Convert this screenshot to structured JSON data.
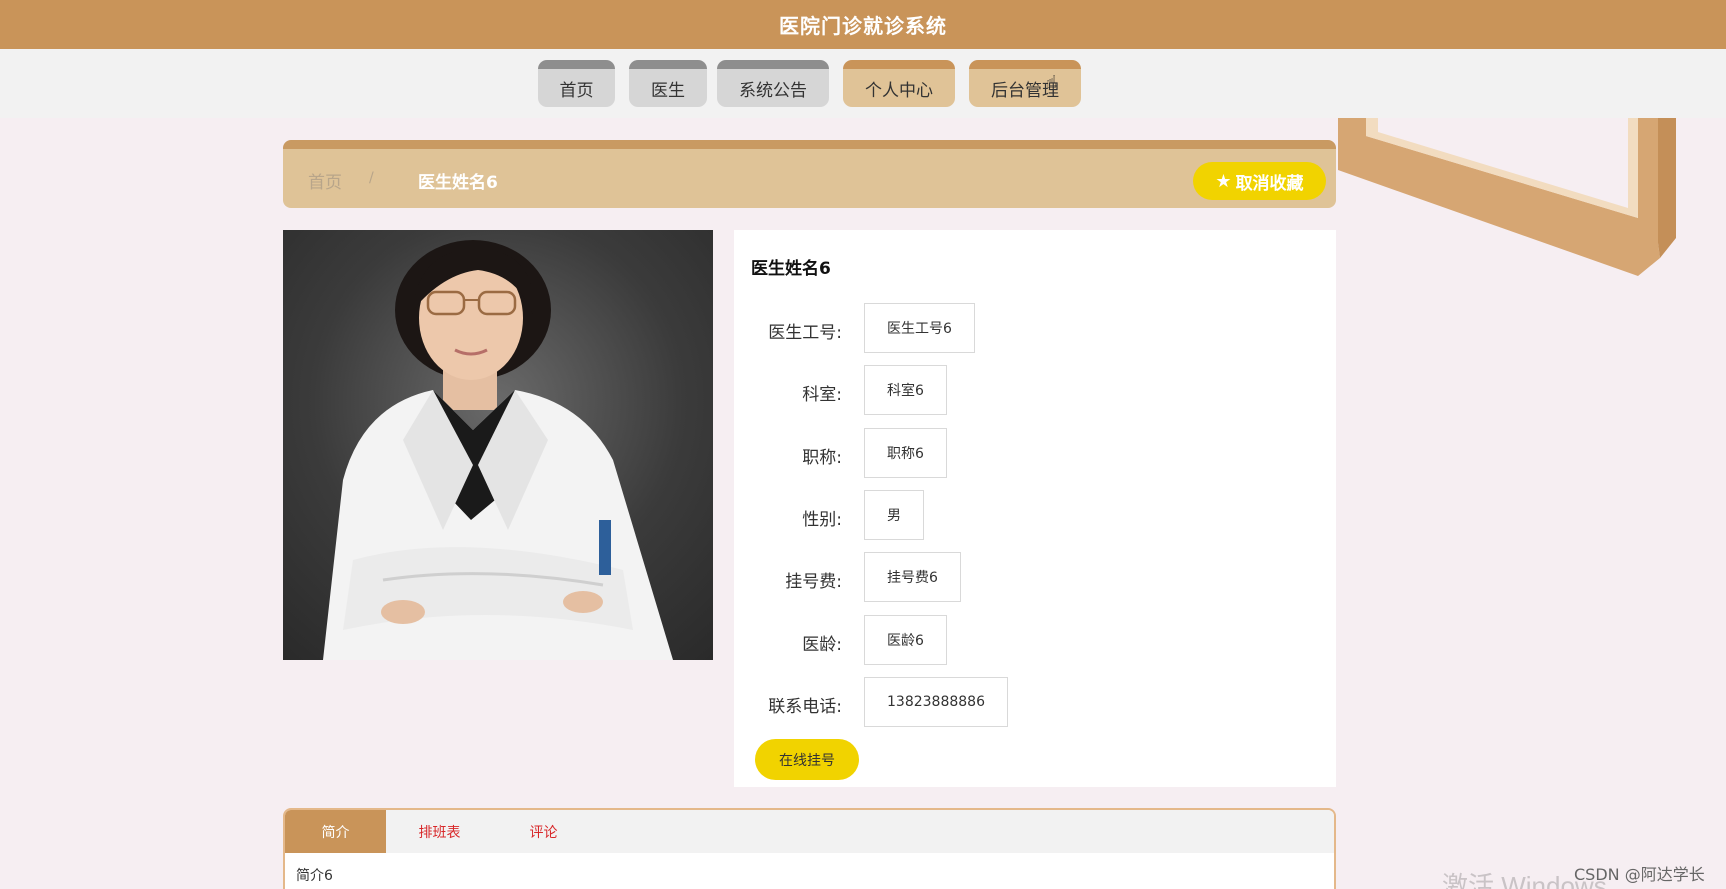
{
  "app": {
    "title": "医院门诊就诊系统"
  },
  "nav": {
    "items": [
      {
        "label": "首页"
      },
      {
        "label": "医生"
      },
      {
        "label": "系统公告"
      },
      {
        "label": "个人中心"
      },
      {
        "label": "后台管理"
      }
    ]
  },
  "breadcrumb": {
    "home": "首页",
    "separator": "/",
    "current": "医生姓名6",
    "favorite_label": "取消收藏",
    "favorite_icon": "star-icon"
  },
  "doctor": {
    "name": "医生姓名6",
    "photo_alt": "doctor-photo",
    "fields": [
      {
        "label": "医生工号:",
        "value": "医生工号6"
      },
      {
        "label": "科室:",
        "value": "科室6"
      },
      {
        "label": "职称:",
        "value": "职称6"
      },
      {
        "label": "性别:",
        "value": "男"
      },
      {
        "label": "挂号费:",
        "value": "挂号费6"
      },
      {
        "label": "医龄:",
        "value": "医龄6"
      },
      {
        "label": "联系电话:",
        "value": "13823888886"
      }
    ],
    "book_label": "在线挂号"
  },
  "tabs": {
    "items": [
      {
        "label": "简介"
      },
      {
        "label": "排班表"
      },
      {
        "label": "评论"
      }
    ],
    "active_content": "简介6"
  },
  "watermarks": {
    "windows": "激活 Windows",
    "csdn": "CSDN @阿达学长"
  },
  "colors": {
    "header": "#c99459",
    "accent_yellow": "#f1d300",
    "tab_text": "#d8282a"
  }
}
